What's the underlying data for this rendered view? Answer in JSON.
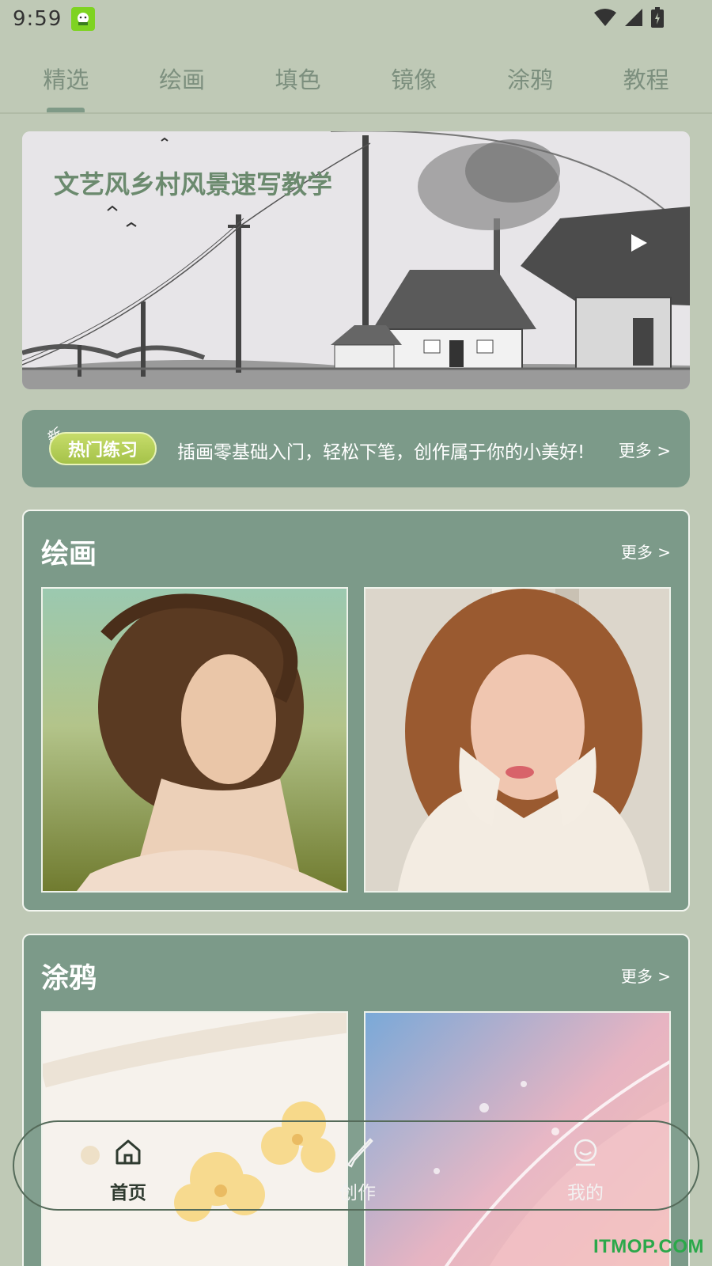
{
  "status_bar": {
    "time": "9:59"
  },
  "tabs": [
    {
      "label": "精选",
      "active": true
    },
    {
      "label": "绘画",
      "active": false
    },
    {
      "label": "填色",
      "active": false
    },
    {
      "label": "镜像",
      "active": false
    },
    {
      "label": "涂鸦",
      "active": false
    },
    {
      "label": "教程",
      "active": false
    }
  ],
  "banner": {
    "title": "文艺风乡村风景速写教学"
  },
  "hot_practice": {
    "new_tag": "新",
    "badge": "热门练习",
    "description": "插画零基础入门，轻松下笔，创作属于你的小美好!",
    "more": "更多 >"
  },
  "sections": [
    {
      "title": "绘画",
      "more": "更多 >"
    },
    {
      "title": "涂鸦",
      "more": "更多 >"
    }
  ],
  "bottom_nav": [
    {
      "label": "首页",
      "icon": "home-icon",
      "active": true
    },
    {
      "label": "创作",
      "icon": "brush-icon",
      "active": false
    },
    {
      "label": "我的",
      "icon": "user-icon",
      "active": false
    }
  ],
  "watermark": "ITMOP.COM",
  "colors": {
    "background": "#bfc9b6",
    "card": "#7c9a89",
    "tab_text": "#7c8f7e",
    "badge": "#a5c249",
    "watermark": "#2ba84a"
  }
}
